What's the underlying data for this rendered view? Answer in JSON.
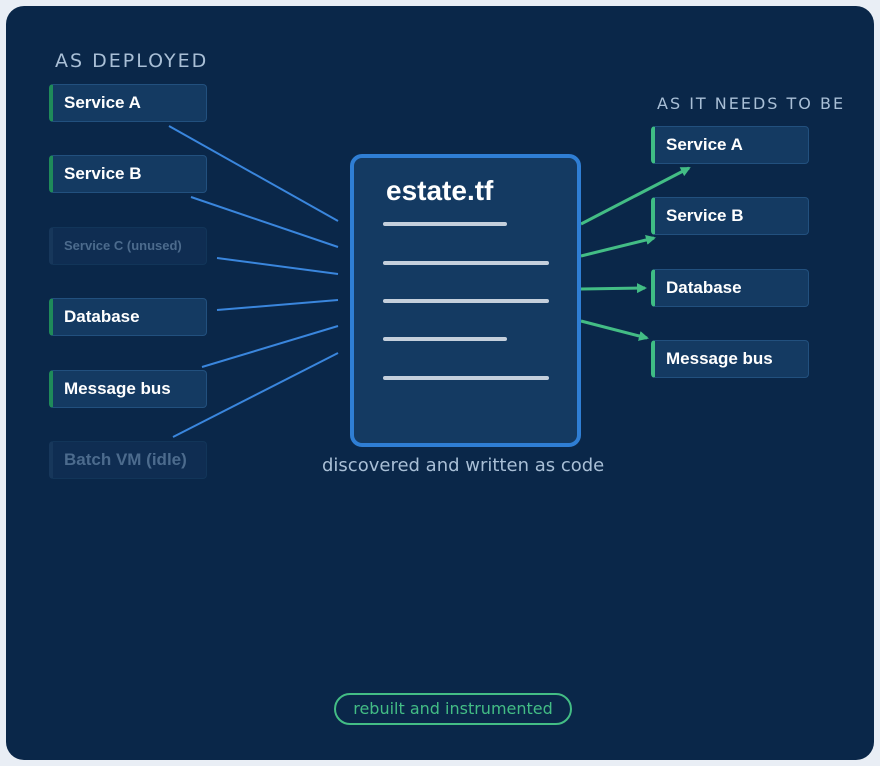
{
  "left_title": "AS DEPLOYED",
  "right_title": "AS IT NEEDS TO BE",
  "deployed_items": [
    {
      "label": "Service A",
      "state": "active"
    },
    {
      "label": "Service B",
      "state": "active"
    },
    {
      "label": "Service C (unused)",
      "state": "faded"
    },
    {
      "label": "Database",
      "state": "active"
    },
    {
      "label": "Message bus",
      "state": "active"
    },
    {
      "label": "Batch VM (idle)",
      "state": "faded"
    }
  ],
  "target_items": [
    {
      "label": "Service A"
    },
    {
      "label": "Service B"
    },
    {
      "label": "Database"
    },
    {
      "label": "Message bus"
    }
  ],
  "document": {
    "title": "estate.tf",
    "line_count": 5
  },
  "caption": "discovered and written as code",
  "badge": "rebuilt and instrumented",
  "colors": {
    "background": "#0a2749",
    "inbound_link": "#3a86dd",
    "outbound_arrow": "#43bd85",
    "document_border": "#2f7ed4",
    "accent_green": "#1f8a5a"
  }
}
